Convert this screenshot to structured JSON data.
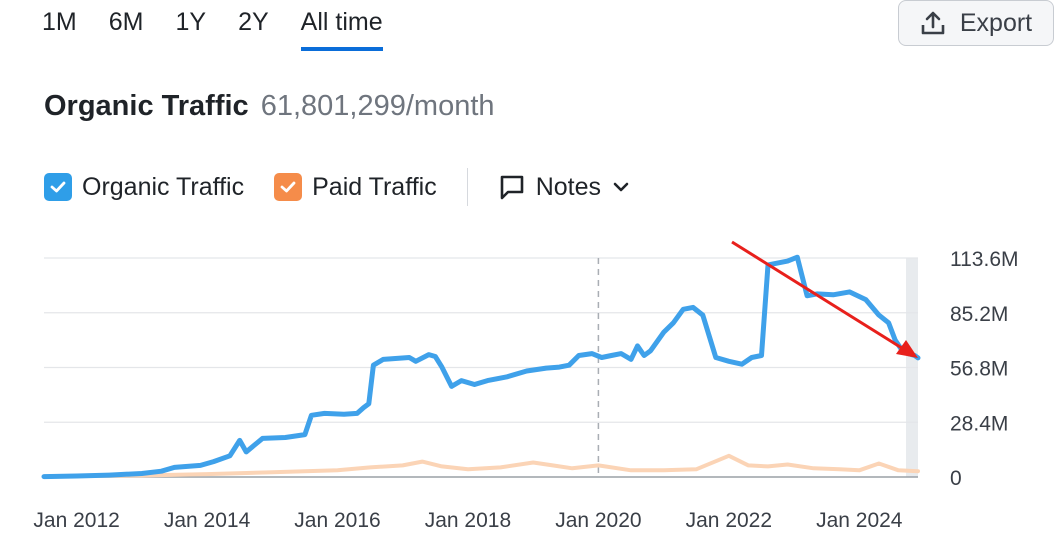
{
  "tabs": [
    {
      "label": "1M",
      "active": false
    },
    {
      "label": "6M",
      "active": false
    },
    {
      "label": "1Y",
      "active": false
    },
    {
      "label": "2Y",
      "active": false
    },
    {
      "label": "All time",
      "active": true
    }
  ],
  "export_label": "Export",
  "header": {
    "title": "Organic Traffic",
    "value": "61,801,299/month"
  },
  "legend": {
    "organic": {
      "label": "Organic Traffic",
      "color": "#2f9ee8"
    },
    "paid": {
      "label": "Paid Traffic",
      "color": "#f58c4a"
    },
    "notes": "Notes"
  },
  "chart_data": {
    "type": "line",
    "y_tick_labels": [
      "113.6M",
      "85.2M",
      "56.8M",
      "28.4M",
      "0"
    ],
    "x_tick_labels": [
      "Jan 2012",
      "Jan 2014",
      "Jan 2016",
      "Jan 2018",
      "Jan 2020",
      "Jan 2022",
      "Jan 2024"
    ],
    "ylim": [
      0,
      113.6
    ],
    "xlim": [
      2011.5,
      2024.9
    ],
    "grid": true,
    "series": [
      {
        "name": "Organic Traffic",
        "color": "#3fa1ea",
        "points": [
          [
            2011.5,
            0.2
          ],
          [
            2012.0,
            0.5
          ],
          [
            2012.5,
            1.0
          ],
          [
            2013.0,
            1.8
          ],
          [
            2013.3,
            3.0
          ],
          [
            2013.5,
            5.0
          ],
          [
            2013.9,
            6.0
          ],
          [
            2014.1,
            8.0
          ],
          [
            2014.35,
            11.0
          ],
          [
            2014.5,
            19.0
          ],
          [
            2014.6,
            13.0
          ],
          [
            2014.85,
            20.0
          ],
          [
            2015.2,
            20.5
          ],
          [
            2015.5,
            22.0
          ],
          [
            2015.6,
            32.0
          ],
          [
            2015.8,
            33.0
          ],
          [
            2016.1,
            32.5
          ],
          [
            2016.3,
            33.0
          ],
          [
            2016.4,
            36.0
          ],
          [
            2016.48,
            38.0
          ],
          [
            2016.55,
            58.0
          ],
          [
            2016.7,
            61.0
          ],
          [
            2017.1,
            62.0
          ],
          [
            2017.2,
            60.0
          ],
          [
            2017.4,
            63.5
          ],
          [
            2017.5,
            62.5
          ],
          [
            2017.6,
            57.0
          ],
          [
            2017.75,
            47.0
          ],
          [
            2017.9,
            50.0
          ],
          [
            2018.1,
            48.0
          ],
          [
            2018.3,
            50.0
          ],
          [
            2018.6,
            52.0
          ],
          [
            2018.9,
            55.0
          ],
          [
            2019.2,
            56.5
          ],
          [
            2019.4,
            57.0
          ],
          [
            2019.55,
            58.0
          ],
          [
            2019.7,
            63.0
          ],
          [
            2019.9,
            64.0
          ],
          [
            2020.05,
            62.0
          ],
          [
            2020.2,
            63.0
          ],
          [
            2020.35,
            64.0
          ],
          [
            2020.5,
            61.0
          ],
          [
            2020.6,
            68.0
          ],
          [
            2020.7,
            63.0
          ],
          [
            2020.8,
            65.5
          ],
          [
            2021.0,
            75.0
          ],
          [
            2021.15,
            80.0
          ],
          [
            2021.3,
            87.0
          ],
          [
            2021.45,
            88.0
          ],
          [
            2021.6,
            84.0
          ],
          [
            2021.8,
            62.0
          ],
          [
            2022.0,
            60.0
          ],
          [
            2022.2,
            58.5
          ],
          [
            2022.35,
            62.0
          ],
          [
            2022.5,
            63.0
          ],
          [
            2022.6,
            110.0
          ],
          [
            2022.9,
            112.0
          ],
          [
            2023.05,
            114.0
          ],
          [
            2023.2,
            94.0
          ],
          [
            2023.35,
            95.0
          ],
          [
            2023.6,
            94.5
          ],
          [
            2023.85,
            96.0
          ],
          [
            2024.1,
            92.0
          ],
          [
            2024.3,
            84.0
          ],
          [
            2024.45,
            80.0
          ],
          [
            2024.55,
            71.0
          ],
          [
            2024.65,
            66.0
          ],
          [
            2024.75,
            64.0
          ],
          [
            2024.85,
            63.0
          ],
          [
            2024.9,
            61.8
          ]
        ]
      },
      {
        "name": "Paid Traffic",
        "color": "#fbd4b6",
        "points": [
          [
            2011.5,
            0.3
          ],
          [
            2013.0,
            0.8
          ],
          [
            2014.0,
            1.5
          ],
          [
            2015.0,
            2.5
          ],
          [
            2015.5,
            3.0
          ],
          [
            2016.0,
            3.5
          ],
          [
            2016.5,
            5.0
          ],
          [
            2017.0,
            6.0
          ],
          [
            2017.3,
            8.0
          ],
          [
            2017.6,
            5.5
          ],
          [
            2018.0,
            4.0
          ],
          [
            2018.5,
            5.0
          ],
          [
            2019.0,
            7.5
          ],
          [
            2019.3,
            6.0
          ],
          [
            2019.6,
            4.5
          ],
          [
            2020.0,
            6.0
          ],
          [
            2020.5,
            3.5
          ],
          [
            2021.0,
            3.5
          ],
          [
            2021.5,
            4.0
          ],
          [
            2022.0,
            11.0
          ],
          [
            2022.3,
            6.0
          ],
          [
            2022.6,
            5.5
          ],
          [
            2022.9,
            6.5
          ],
          [
            2023.3,
            4.5
          ],
          [
            2023.7,
            4.0
          ],
          [
            2024.0,
            3.5
          ],
          [
            2024.3,
            7.0
          ],
          [
            2024.6,
            3.5
          ],
          [
            2024.9,
            3.0
          ]
        ]
      }
    ]
  }
}
